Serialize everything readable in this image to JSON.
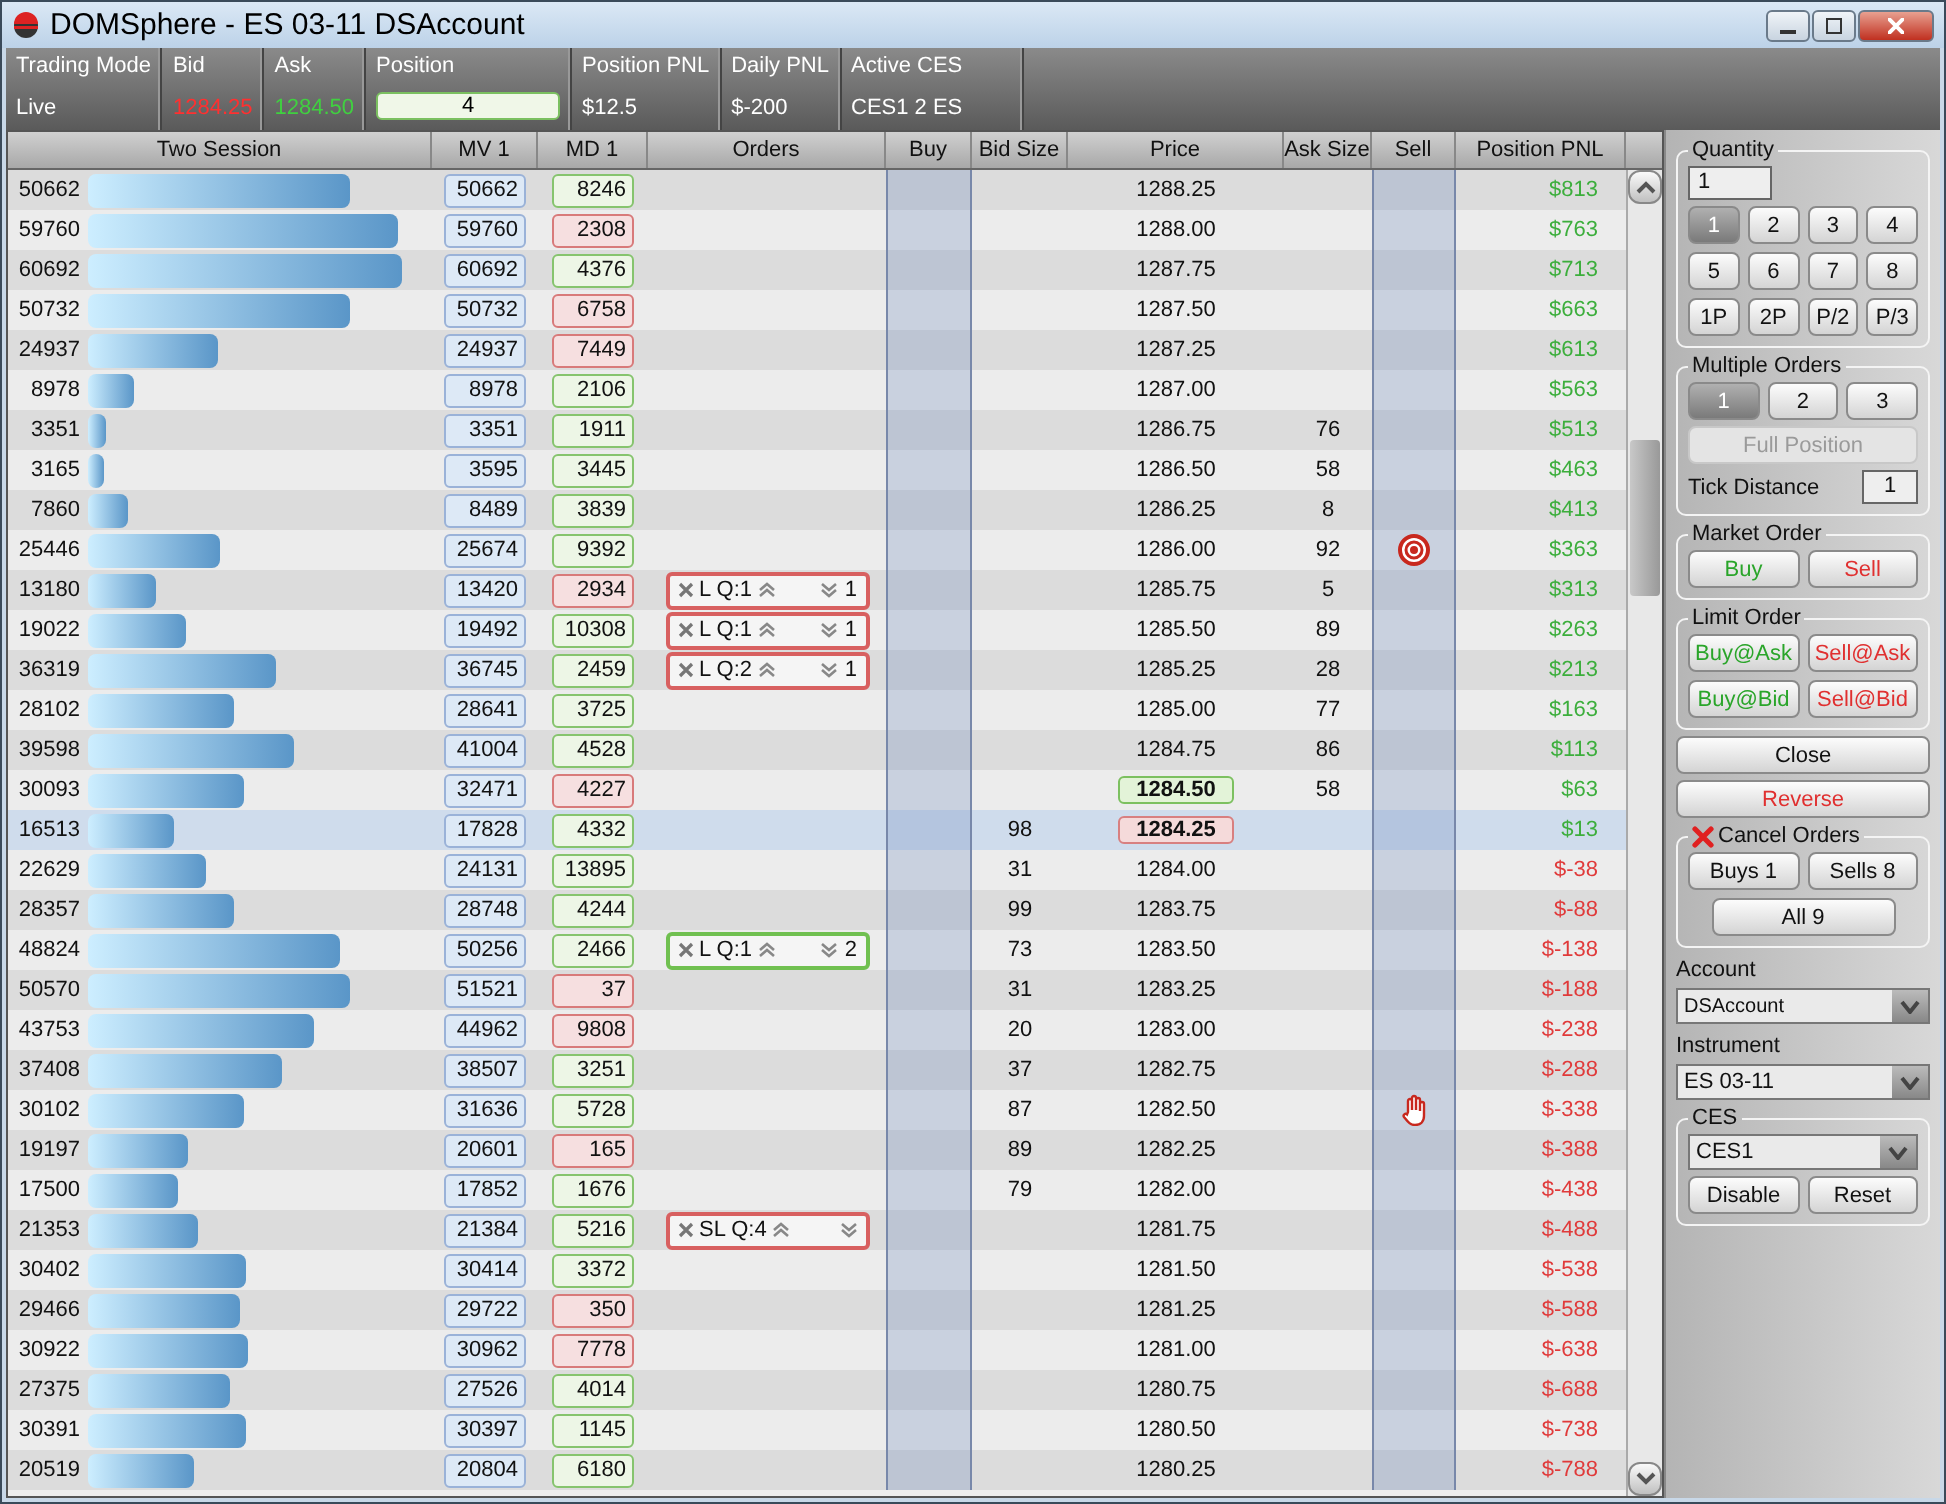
{
  "window": {
    "title": "DOMSphere - ES 03-11 DSAccount"
  },
  "stats": [
    {
      "label": "Trading Mode",
      "value": "Live",
      "kind": "text"
    },
    {
      "label": "Bid",
      "value": "1284.25",
      "kind": "bid"
    },
    {
      "label": "Ask",
      "value": "1284.50",
      "kind": "ask"
    },
    {
      "label": "Position",
      "value": "4",
      "kind": "field"
    },
    {
      "label": "Position PNL",
      "value": "$12.5",
      "kind": "text"
    },
    {
      "label": "Daily PNL",
      "value": "$-200",
      "kind": "text"
    },
    {
      "label": "Active CES",
      "value": "CES1 2 ES",
      "kind": "text"
    }
  ],
  "columns": [
    "Two Session",
    "MV 1",
    "MD 1",
    "Orders",
    "Buy",
    "Bid Size",
    "Price",
    "Ask Size",
    "Sell",
    "Position PNL"
  ],
  "rows": [
    {
      "session": "50662",
      "mv": "50662",
      "md": "8246",
      "md_up": true,
      "price": "1288.25",
      "pnl": "$813",
      "pnl_positive": true
    },
    {
      "session": "59760",
      "mv": "59760",
      "md": "2308",
      "md_up": false,
      "price": "1288.00",
      "pnl": "$763",
      "pnl_positive": true
    },
    {
      "session": "60692",
      "mv": "60692",
      "md": "4376",
      "md_up": true,
      "price": "1287.75",
      "pnl": "$713",
      "pnl_positive": true
    },
    {
      "session": "50732",
      "mv": "50732",
      "md": "6758",
      "md_up": false,
      "price": "1287.50",
      "pnl": "$663",
      "pnl_positive": true
    },
    {
      "session": "24937",
      "mv": "24937",
      "md": "7449",
      "md_up": false,
      "price": "1287.25",
      "pnl": "$613",
      "pnl_positive": true
    },
    {
      "session": "8978",
      "mv": "8978",
      "md": "2106",
      "md_up": true,
      "price": "1287.00",
      "pnl": "$563",
      "pnl_positive": true
    },
    {
      "session": "3351",
      "mv": "3351",
      "md": "1911",
      "md_up": true,
      "price": "1286.75",
      "ask_size": "76",
      "pnl": "$513",
      "pnl_positive": true
    },
    {
      "session": "3165",
      "mv": "3595",
      "md": "3445",
      "md_up": true,
      "price": "1286.50",
      "ask_size": "58",
      "pnl": "$463",
      "pnl_positive": true
    },
    {
      "session": "7860",
      "mv": "8489",
      "md": "3839",
      "md_up": true,
      "price": "1286.25",
      "ask_size": "8",
      "pnl": "$413",
      "pnl_positive": true
    },
    {
      "session": "25446",
      "mv": "25674",
      "md": "9392",
      "md_up": true,
      "price": "1286.00",
      "ask_size": "92",
      "sell_marker": {
        "kind": "target"
      },
      "pnl": "$363",
      "pnl_positive": true
    },
    {
      "session": "13180",
      "mv": "13420",
      "md": "2934",
      "md_up": false,
      "order": {
        "label": "L Q:1",
        "count": "1",
        "kind": "sell"
      },
      "price": "1285.75",
      "ask_size": "5",
      "pnl": "$313",
      "pnl_positive": true
    },
    {
      "session": "19022",
      "mv": "19492",
      "md": "10308",
      "md_up": true,
      "order": {
        "label": "L Q:1",
        "count": "1",
        "kind": "sell"
      },
      "price": "1285.50",
      "ask_size": "89",
      "pnl": "$263",
      "pnl_positive": true
    },
    {
      "session": "36319",
      "mv": "36745",
      "md": "2459",
      "md_up": true,
      "order": {
        "label": "L Q:2",
        "count": "1",
        "kind": "sell"
      },
      "price": "1285.25",
      "ask_size": "28",
      "pnl": "$213",
      "pnl_positive": true
    },
    {
      "session": "28102",
      "mv": "28641",
      "md": "3725",
      "md_up": true,
      "price": "1285.00",
      "ask_size": "77",
      "pnl": "$163",
      "pnl_positive": true
    },
    {
      "session": "39598",
      "mv": "41004",
      "md": "4528",
      "md_up": true,
      "price": "1284.75",
      "ask_size": "86",
      "pnl": "$113",
      "pnl_positive": true
    },
    {
      "session": "30093",
      "mv": "32471",
      "md": "4227",
      "md_up": false,
      "price": "1284.50",
      "quote": {
        "kind": "ask"
      },
      "ask_size": "58",
      "pnl": "$63",
      "pnl_positive": true
    },
    {
      "session": "16513",
      "mv": "17828",
      "md": "4332",
      "md_up": true,
      "bid_size": "98",
      "price": "1284.25",
      "quote": {
        "kind": "bid"
      },
      "pnl": "$13",
      "pnl_positive": true,
      "highlighted": true
    },
    {
      "session": "22629",
      "mv": "24131",
      "md": "13895",
      "md_up": true,
      "bid_size": "31",
      "price": "1284.00",
      "pnl": "$-38",
      "pnl_positive": false
    },
    {
      "session": "28357",
      "mv": "28748",
      "md": "4244",
      "md_up": true,
      "bid_size": "99",
      "price": "1283.75",
      "pnl": "$-88",
      "pnl_positive": false
    },
    {
      "session": "48824",
      "mv": "50256",
      "md": "2466",
      "md_up": true,
      "order": {
        "label": "L Q:1",
        "count": "2",
        "kind": "buy"
      },
      "bid_size": "73",
      "price": "1283.50",
      "pnl": "$-138",
      "pnl_positive": false
    },
    {
      "session": "50570",
      "mv": "51521",
      "md": "37",
      "md_up": false,
      "bid_size": "31",
      "price": "1283.25",
      "pnl": "$-188",
      "pnl_positive": false
    },
    {
      "session": "43753",
      "mv": "44962",
      "md": "9808",
      "md_up": false,
      "bid_size": "20",
      "price": "1283.00",
      "pnl": "$-238",
      "pnl_positive": false
    },
    {
      "session": "37408",
      "mv": "38507",
      "md": "3251",
      "md_up": true,
      "bid_size": "37",
      "price": "1282.75",
      "pnl": "$-288",
      "pnl_positive": false
    },
    {
      "session": "30102",
      "mv": "31636",
      "md": "5728",
      "md_up": true,
      "bid_size": "87",
      "price": "1282.50",
      "sell_marker": {
        "kind": "hand"
      },
      "pnl": "$-338",
      "pnl_positive": false
    },
    {
      "session": "19197",
      "mv": "20601",
      "md": "165",
      "md_up": false,
      "bid_size": "89",
      "price": "1282.25",
      "pnl": "$-388",
      "pnl_positive": false
    },
    {
      "session": "17500",
      "mv": "17852",
      "md": "1676",
      "md_up": true,
      "bid_size": "79",
      "price": "1282.00",
      "pnl": "$-438",
      "pnl_positive": false
    },
    {
      "session": "21353",
      "mv": "21384",
      "md": "5216",
      "md_up": true,
      "order": {
        "label": "SL Q:4",
        "kind": "sell"
      },
      "price": "1281.75",
      "pnl": "$-488",
      "pnl_positive": false
    },
    {
      "session": "30402",
      "mv": "30414",
      "md": "3372",
      "md_up": true,
      "price": "1281.50",
      "pnl": "$-538",
      "pnl_positive": false
    },
    {
      "session": "29466",
      "mv": "29722",
      "md": "350",
      "md_up": false,
      "price": "1281.25",
      "pnl": "$-588",
      "pnl_positive": false
    },
    {
      "session": "30922",
      "mv": "30962",
      "md": "7778",
      "md_up": false,
      "price": "1281.00",
      "pnl": "$-638",
      "pnl_positive": false
    },
    {
      "session": "27375",
      "mv": "27526",
      "md": "4014",
      "md_up": true,
      "price": "1280.75",
      "pnl": "$-688",
      "pnl_positive": false
    },
    {
      "session": "30391",
      "mv": "30397",
      "md": "1145",
      "md_up": true,
      "price": "1280.50",
      "pnl": "$-738",
      "pnl_positive": false
    },
    {
      "session": "20519",
      "mv": "20804",
      "md": "6180",
      "md_up": true,
      "price": "1280.25",
      "pnl": "$-788",
      "pnl_positive": false
    }
  ],
  "quantity": {
    "title": "Quantity",
    "value": "1",
    "buttons": [
      {
        "label": "1",
        "selected": true
      },
      {
        "label": "2",
        "selected": false
      },
      {
        "label": "3",
        "selected": false
      },
      {
        "label": "4",
        "selected": false
      },
      {
        "label": "5",
        "selected": false
      },
      {
        "label": "6",
        "selected": false
      },
      {
        "label": "7",
        "selected": false
      },
      {
        "label": "8",
        "selected": false
      },
      {
        "label": "1P",
        "selected": false
      },
      {
        "label": "2P",
        "selected": false
      },
      {
        "label": "P/2",
        "selected": false
      },
      {
        "label": "P/3",
        "selected": false
      }
    ]
  },
  "multiple_orders": {
    "title": "Multiple Orders",
    "buttons": [
      {
        "label": "1",
        "selected": true
      },
      {
        "label": "2",
        "selected": false
      },
      {
        "label": "3",
        "selected": false
      }
    ],
    "full_position": {
      "label": "Full Position",
      "disabled": true
    },
    "tick_distance": {
      "label": "Tick Distance",
      "value": "1"
    }
  },
  "market_order": {
    "title": "Market Order",
    "buttons": [
      {
        "label": "Buy",
        "kind": "buy"
      },
      {
        "label": "Sell",
        "kind": "sell"
      }
    ]
  },
  "limit_order": {
    "title": "Limit Order",
    "buttons": [
      {
        "label": "Buy@Ask",
        "kind": "buy"
      },
      {
        "label": "Sell@Ask",
        "kind": "sell"
      },
      {
        "label": "Buy@Bid",
        "kind": "buy"
      },
      {
        "label": "Sell@Bid",
        "kind": "sell"
      }
    ]
  },
  "actions": [
    {
      "label": "Close",
      "kind": "neutral"
    },
    {
      "label": "Reverse",
      "kind": "sell"
    }
  ],
  "cancel_orders": {
    "title": "Cancel Orders",
    "buttons": [
      "Buys 1",
      "Sells 8",
      "All 9"
    ]
  },
  "account": {
    "label": "Account",
    "value": "DSAccount"
  },
  "instrument": {
    "label": "Instrument",
    "value": "ES 03-11"
  },
  "ces": {
    "title": "CES",
    "value": "CES1",
    "buttons": [
      "Disable",
      "Reset"
    ]
  }
}
